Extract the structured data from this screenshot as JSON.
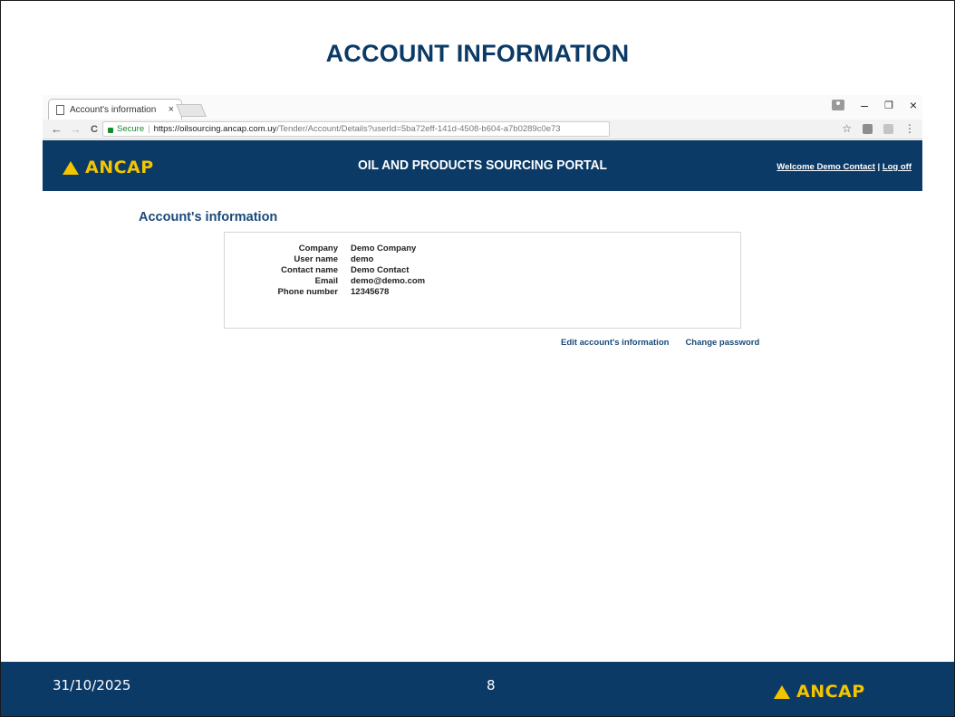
{
  "slide": {
    "title": "ACCOUNT INFORMATION"
  },
  "browser": {
    "tab_title": "Account's information",
    "tab_close": "×",
    "nav": {
      "back": "←",
      "forward": "→",
      "reload": "C"
    },
    "secure_label": "Secure",
    "url_host": "https://oilsourcing.ancap.com.uy",
    "url_path": "/Tender/Account/Details?userId=5ba72eff-141d-4508-b604-a7b0289c0e73",
    "window_controls": {
      "minimize": "–",
      "restore": "❐",
      "close": "×"
    },
    "bookmark_star": "☆",
    "menu": "⋮"
  },
  "site_header": {
    "logo_text": "ANCAP",
    "portal_title": "OIL AND PRODUCTS SOURCING PORTAL",
    "welcome_link": "Welcome Demo Contact",
    "separator": " | ",
    "logoff_link": "Log off"
  },
  "page": {
    "heading": "Account's information",
    "fields": [
      {
        "label": "Company",
        "value": "Demo Company"
      },
      {
        "label": "User name",
        "value": "demo"
      },
      {
        "label": "Contact name",
        "value": "Demo Contact"
      },
      {
        "label": "Email",
        "value": "demo@demo.com"
      },
      {
        "label": "Phone number",
        "value": "12345678"
      }
    ],
    "edit_link": "Edit account's information",
    "change_password_link": "Change password"
  },
  "footer": {
    "date": "31/10/2025",
    "page_number": "8",
    "logo_text": "ANCAP"
  },
  "colors": {
    "brand_navy": "#0b3a66",
    "brand_yellow": "#f3c400",
    "link_blue": "#1a4a7a",
    "secure_green": "#168a2c"
  }
}
